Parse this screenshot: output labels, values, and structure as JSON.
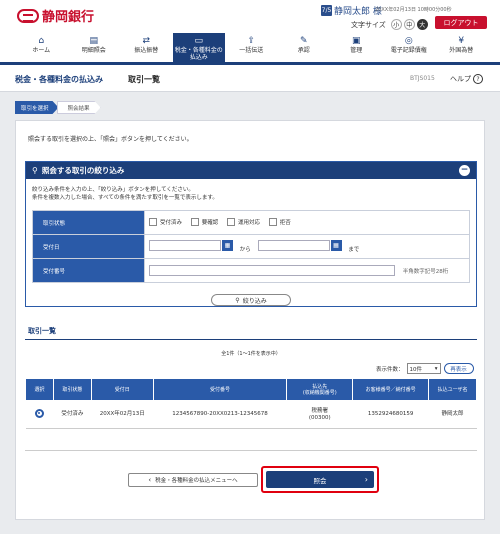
{
  "header": {
    "bank_name": "静岡銀行",
    "user_icon": "7/5",
    "user_name": "静岡太郎 様",
    "login_info": "20XX年02月13日 10時00分00秒",
    "font_size_label": "文字サイズ",
    "font_sizes": [
      "小",
      "中",
      "大"
    ],
    "font_size_selected": "大",
    "logout_label": "ログアウト"
  },
  "nav": {
    "items": [
      {
        "label": "ホーム",
        "icon": "home-icon"
      },
      {
        "label": "明細照会",
        "icon": "document-icon"
      },
      {
        "label": "振込振替",
        "icon": "transfer-icon"
      },
      {
        "label": "税金・各種料金の払込み",
        "icon": "tax-payment-icon"
      },
      {
        "label": "一括伝送",
        "icon": "bulk-transfer-icon"
      },
      {
        "label": "承認",
        "icon": "approval-icon"
      },
      {
        "label": "管理",
        "icon": "admin-icon"
      },
      {
        "label": "電子記録債権",
        "icon": "e-bond-icon"
      },
      {
        "label": "外国為替",
        "icon": "forex-icon"
      }
    ],
    "active": "税金・各種料金の払込み"
  },
  "title": {
    "service": "税金・各種料金の払込み",
    "page": "取引一覧",
    "page_id": "BTJS015",
    "help_label": "ヘルプ"
  },
  "steps": [
    "取引を選択",
    "照会結果"
  ],
  "instruction": "照会する取引を選択の上、「照会」ボタンを押してください。",
  "filter": {
    "heading": "照会する取引の絞り込み",
    "desc1": "絞り込み条件を入力の上、「絞り込み」ボタンを押してください。",
    "desc2": "条件を複数入力した場合、すべての条件を満たす取引を一覧で表示します。",
    "status_label": "取引状態",
    "status_options": [
      "受付済み",
      "要確認",
      "運用対応",
      "拒否"
    ],
    "date_label": "受付日",
    "date_from": "から",
    "date_to": "まで",
    "number_label": "受付番号",
    "number_hint": "半角数字記号28桁",
    "search_button": "絞り込み"
  },
  "list": {
    "heading": "取引一覧",
    "count": "全1件（1〜1件を表示中）",
    "display_count_label": "表示件数：",
    "display_count_value": "10件",
    "redisplay_button": "再表示",
    "columns": [
      "選択",
      "取引状態",
      "受付日",
      "受付番号",
      "払込先\n(収納機関番号)",
      "お客様番号／納付番号",
      "払込ユーザ名"
    ],
    "rows": [
      {
        "status": "受付済み",
        "date": "20XX年02月13日",
        "number": "1234567890-20XX0213-12345678",
        "payee": "税務署",
        "payee_code": "(00300)",
        "customer_no": "1352924680159",
        "user": "静岡太郎"
      }
    ]
  },
  "buttons": {
    "back": "税金・各種料金の払込メニューへ",
    "submit": "照会"
  }
}
